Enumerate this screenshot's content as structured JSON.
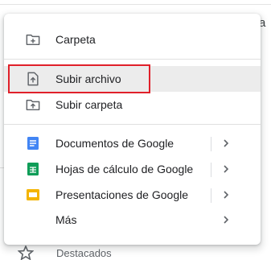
{
  "background": {
    "top_right_text": "a",
    "bottom_item_label": "Destacados"
  },
  "menu": {
    "items": [
      {
        "label": "Carpeta",
        "icon": "new-folder-icon"
      },
      {
        "label": "Subir archivo",
        "icon": "file-upload-icon",
        "highlighted": true
      },
      {
        "label": "Subir carpeta",
        "icon": "folder-upload-icon"
      },
      {
        "label": "Documentos de Google",
        "icon": "google-docs-icon",
        "submenu": true
      },
      {
        "label": "Hojas de cálculo de Google",
        "icon": "google-sheets-icon",
        "submenu": true
      },
      {
        "label": "Presentaciones de Google",
        "icon": "google-slides-icon",
        "submenu": true
      },
      {
        "label": "Más",
        "submenu": true
      }
    ]
  },
  "colors": {
    "docs": "#4285f4",
    "sheets": "#0f9d58",
    "slides": "#f4b400",
    "highlight_border": "#e0202a"
  }
}
